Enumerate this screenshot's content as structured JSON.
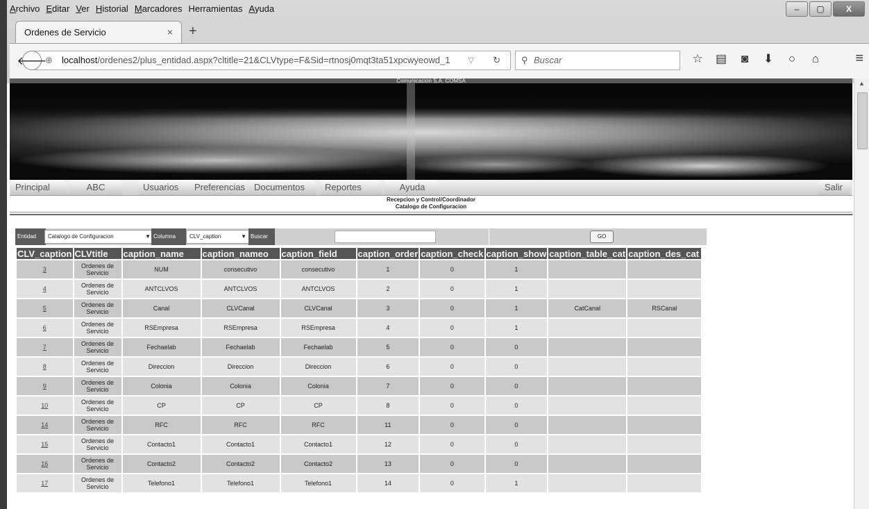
{
  "browser": {
    "menu": [
      "Archivo",
      "Editar",
      "Ver",
      "Historial",
      "Marcadores",
      "Herramientas",
      "Ayuda"
    ],
    "tab_title": "Ordenes de Servicio",
    "tab_close": "×",
    "new_tab": "+",
    "url_host": "localhost",
    "url_path": "/ordenes2/plus_entidad.aspx?cltitle=21&CLVtype=F&Sid=rtnosj0mqt3ta51xpcwyeowd_1",
    "search_placeholder": "Buscar",
    "window_buttons": [
      "–",
      "▢",
      "X"
    ]
  },
  "banner": {
    "title": "Comunicacion S.A. COMSA"
  },
  "nav": {
    "items": [
      "Principal",
      "ABC",
      "Usuarios",
      "Preferencias",
      "Documentos",
      "Reportes",
      "Ayuda"
    ],
    "salir": "Salir"
  },
  "subtitle": {
    "line1": "Recepcion y Control/Coordinador",
    "line2": "Catalogo de Configuracion"
  },
  "filter": {
    "entidad_label": "Entidad",
    "entidad_value": "Catalogo de Configuracion",
    "columna_label": "Columna",
    "columna_value": "CLV_caption",
    "buscar_label": "Buscar",
    "buscar_value": "",
    "go_label": "GO"
  },
  "table": {
    "headers": [
      "CLV_caption",
      "CLVtitle",
      "caption_name",
      "caption_nameo",
      "caption_field",
      "caption_order",
      "caption_check",
      "caption_show",
      "caption_table_cat",
      "caption_des_cat"
    ],
    "rows": [
      [
        "3",
        "Ordenes de Servicio",
        "NUM",
        "consecutivo",
        "consecutivo",
        "1",
        "0",
        "1",
        "",
        ""
      ],
      [
        "4",
        "Ordenes de Servicio",
        "ANTCLVOS",
        "ANTCLVOS",
        "ANTCLVOS",
        "2",
        "0",
        "1",
        "",
        ""
      ],
      [
        "5",
        "Ordenes de Servicio",
        "Canal",
        "CLVCanal",
        "CLVCanal",
        "3",
        "0",
        "1",
        "CatCanal",
        "RSCanal"
      ],
      [
        "6",
        "Ordenes de Servicio",
        "RSEmpresa",
        "RSEmpresa",
        "RSEmpresa",
        "4",
        "0",
        "1",
        "",
        ""
      ],
      [
        "7",
        "Ordenes de Servicio",
        "Fechaelab",
        "Fechaelab",
        "Fechaelab",
        "5",
        "0",
        "0",
        "",
        ""
      ],
      [
        "8",
        "Ordenes de Servicio",
        "Direccion",
        "Direccion",
        "Direccion",
        "6",
        "0",
        "0",
        "",
        ""
      ],
      [
        "9",
        "Ordenes de Servicio",
        "Colonia",
        "Colonia",
        "Colonia",
        "7",
        "0",
        "0",
        "",
        ""
      ],
      [
        "10",
        "Ordenes de Servicio",
        "CP",
        "CP",
        "CP",
        "8",
        "0",
        "0",
        "",
        ""
      ],
      [
        "14",
        "Ordenes de Servicio",
        "RFC",
        "RFC",
        "RFC",
        "11",
        "0",
        "0",
        "",
        ""
      ],
      [
        "15",
        "Ordenes de Servicio",
        "Contacto1",
        "Contacto1",
        "Contacto1",
        "12",
        "0",
        "0",
        "",
        ""
      ],
      [
        "16",
        "Ordenes de Servicio",
        "Contacto2",
        "Contacto2",
        "Contacto2",
        "13",
        "0",
        "0",
        "",
        ""
      ],
      [
        "17",
        "Ordenes de Servicio",
        "Telefono1",
        "Telefono1",
        "Telefono1",
        "14",
        "0",
        "1",
        "",
        ""
      ]
    ]
  }
}
